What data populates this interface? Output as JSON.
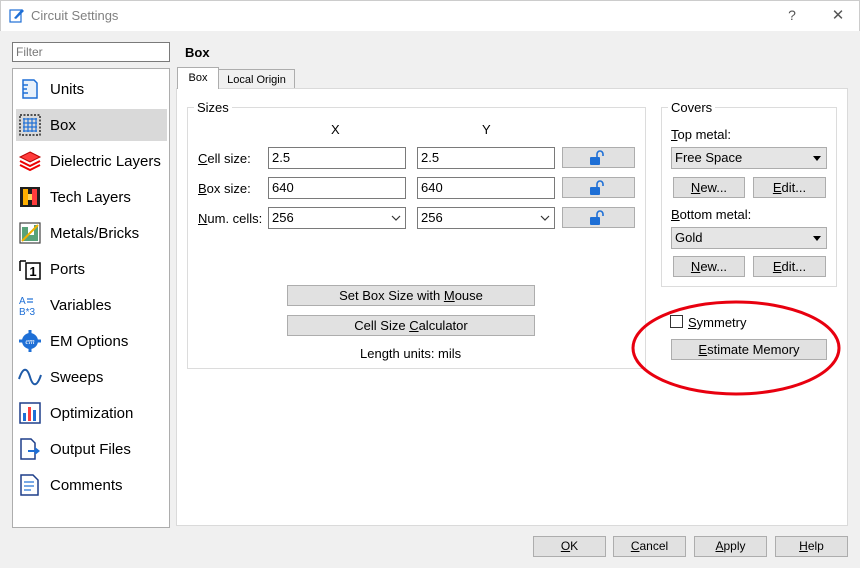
{
  "window": {
    "title": "Circuit Settings",
    "help_label": "?",
    "close_label": "✕"
  },
  "filter": {
    "placeholder": "Filter"
  },
  "sidebar": {
    "items": [
      {
        "label": "Units",
        "icon": "units-icon"
      },
      {
        "label": "Box",
        "icon": "box-grid-icon",
        "active": true
      },
      {
        "label": "Dielectric Layers",
        "icon": "dielectric-layers-icon"
      },
      {
        "label": "Tech Layers",
        "icon": "tech-layers-icon"
      },
      {
        "label": "Metals/Bricks",
        "icon": "metals-bricks-icon"
      },
      {
        "label": "Ports",
        "icon": "ports-icon"
      },
      {
        "label": "Variables",
        "icon": "variables-icon"
      },
      {
        "label": "EM Options",
        "icon": "em-options-icon"
      },
      {
        "label": "Sweeps",
        "icon": "sweeps-icon"
      },
      {
        "label": "Optimization",
        "icon": "optimization-icon"
      },
      {
        "label": "Output Files",
        "icon": "output-files-icon"
      },
      {
        "label": "Comments",
        "icon": "comments-icon"
      }
    ]
  },
  "main": {
    "title": "Box",
    "tabs": [
      {
        "label": "Box",
        "active": true
      },
      {
        "label": "Local Origin",
        "active": false
      }
    ]
  },
  "sizes": {
    "label": "Sizes",
    "col_x": "X",
    "col_y": "Y",
    "cell_size": {
      "label_ul": "C",
      "label_rest": "ell size:",
      "x": "2.5",
      "y": "2.5"
    },
    "box_size": {
      "label_ul": "B",
      "label_rest": "ox size:",
      "x": "640",
      "y": "640"
    },
    "num_cells": {
      "label_ul": "N",
      "label_rest": "um. cells:",
      "x": "256",
      "y": "256"
    },
    "set_box_btn": {
      "pre": "Set Box Size with ",
      "ul": "M",
      "post": "ouse"
    },
    "cell_calc_btn": {
      "pre": "Cell Size ",
      "ul": "C",
      "post": "alculator"
    },
    "length_units": "Length units: mils"
  },
  "covers": {
    "label": "Covers",
    "top_metal_label": {
      "ul": "T",
      "rest": "op metal:"
    },
    "top_metal_value": "Free Space",
    "bottom_metal_label": {
      "ul": "B",
      "rest": "ottom metal:"
    },
    "bottom_metal_value": "Gold",
    "new_btn": {
      "ul": "N",
      "rest": "ew..."
    },
    "edit_btn": {
      "ul": "E",
      "rest": "dit..."
    }
  },
  "symmetry": {
    "ul": "S",
    "rest": "ymmetry",
    "checked": false
  },
  "estimate_btn": {
    "ul": "E",
    "rest": "stimate Memory"
  },
  "footer": {
    "ok": {
      "ul": "O",
      "rest": "K"
    },
    "cancel": {
      "ul": "C",
      "rest": "ancel"
    },
    "apply": {
      "ul": "A",
      "rest": "pply"
    },
    "help": {
      "ul": "H",
      "rest": "elp"
    }
  },
  "annotation": {
    "color": "#e8000f"
  },
  "colors": {
    "accent_blue": "#1e6fd6",
    "selection_gray": "#d9d9d9"
  }
}
